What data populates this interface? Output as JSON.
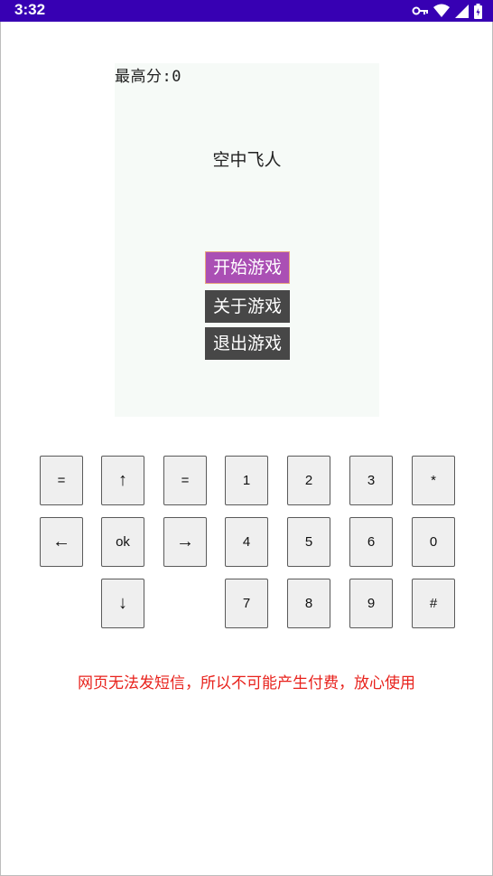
{
  "status_bar": {
    "time": "3:32",
    "icons": [
      "vpn-key-icon",
      "wifi-icon",
      "signal-icon",
      "battery-icon"
    ]
  },
  "game": {
    "highscore": "最高分:0",
    "title": "空中飞人",
    "menu": {
      "start": "开始游戏",
      "about": "关于游戏",
      "exit": "退出游戏"
    }
  },
  "keypad": {
    "row1": [
      "=",
      "↑",
      "=",
      "1",
      "2",
      "3",
      "*"
    ],
    "row2": [
      "←",
      "ok",
      "→",
      "4",
      "5",
      "6",
      "0"
    ],
    "row3": [
      "↓",
      "7",
      "8",
      "9",
      "#"
    ]
  },
  "notice": "网页无法发短信，所以不可能产生付费，放心使用",
  "colors": {
    "status_bar": "#3700b3",
    "menu_active": "#aa4fb4",
    "menu_default": "#474747",
    "notice": "#e8221c"
  }
}
